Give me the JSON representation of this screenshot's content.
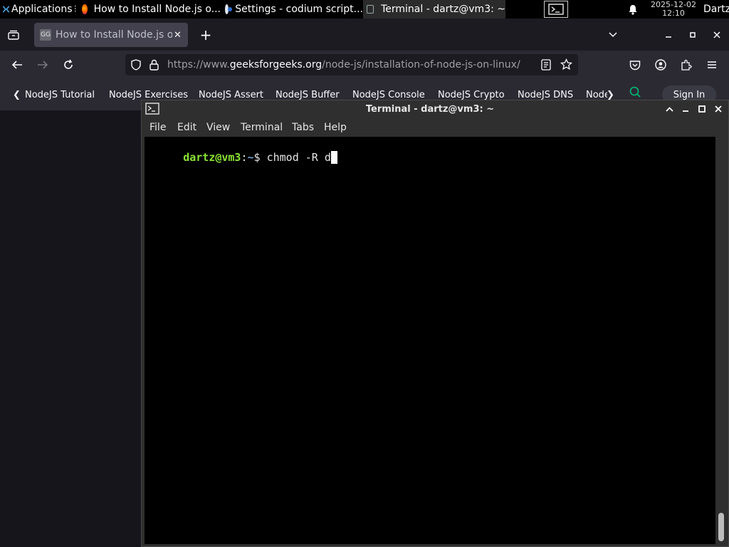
{
  "panel": {
    "apps_label": "Applications",
    "tasks": [
      {
        "label": "How to Install Node.js o...",
        "icon": "firefox-icon"
      },
      {
        "label": "Settings - codium script...",
        "icon": "chromium-icon"
      },
      {
        "label": "Terminal - dartz@vm3: ~",
        "icon": "terminal-icon"
      }
    ],
    "date": "2025-12-02",
    "time": "12:10",
    "user": "Dartz"
  },
  "browser": {
    "tab_title": "How to Install Node.js on",
    "url_prefix": "https://www.",
    "url_domain": "geeksforgeeks.org",
    "url_path": "/node-js/installation-of-node-js-on-linux/",
    "bookmarks": [
      "NodeJS Tutorial",
      "NodeJS Exercises",
      "NodeJS Assert",
      "NodeJS Buffer",
      "NodeJS Console",
      "NodeJS Crypto",
      "NodeJS DNS",
      "NodeJ"
    ],
    "sign_in": "Sign In"
  },
  "terminal": {
    "title": "Terminal - dartz@vm3: ~",
    "menu": [
      "File",
      "Edit",
      "View",
      "Terminal",
      "Tabs",
      "Help"
    ],
    "prompt_user": "dartz@vm3",
    "prompt_sep": ":",
    "prompt_dir": "~",
    "prompt_symbol": "$",
    "command": "chmod -R d"
  },
  "colors": {
    "prompt_green": "#8ae234",
    "prompt_blue": "#729fcf",
    "accent": "#00bb77"
  }
}
